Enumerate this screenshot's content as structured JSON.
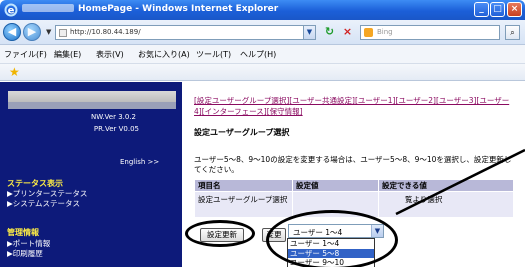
{
  "window": {
    "title": "HomePage - Windows Internet Explorer",
    "min": "_",
    "max": "□",
    "close": "×"
  },
  "nav": {
    "back": "◀",
    "forward": "▶",
    "dropdown": "▼",
    "address": "http://10.80.44.189/",
    "addr_dd": "▼",
    "refresh": "↻",
    "stop": "×",
    "search_placeholder": "Bing",
    "search_go": "⌕"
  },
  "menu": {
    "items": [
      "ファイル(F)",
      "編集(E)",
      "表示(V)",
      "お気に入り(A)",
      "ツール(T)",
      "ヘルプ(H)"
    ]
  },
  "sidebar": {
    "nw_ver": "NW.Ver 3.0.2",
    "pr_ver": "PR.Ver V0.05",
    "lang": "English >>",
    "status_head": "ステータス表示",
    "status_links": [
      "▶プリンターステータス",
      "▶システムステータス"
    ],
    "admin_head": "管理情報",
    "admin_links": [
      "▶ポート情報",
      "▶印刷履歴"
    ]
  },
  "content": {
    "link_segments": [
      "[設定ユーザーグループ選択]",
      "[ユーザー共通設定]",
      "[ユーザー1]",
      "[ユーザー2]",
      "[ユーザー3]",
      "[ユーザー4]",
      "[インターフェース]",
      "[保守情報]"
    ],
    "heading": "設定ユーザーグループ選択",
    "description": "ユーザー5～8、9～10の設定を変更する場合は、ユーザー5～8、9～10を選択し、設定更新してください。",
    "table": {
      "headers": [
        "項目名",
        "設定値",
        "設定できる値"
      ],
      "row_item": "設定ユーザーグループ選択",
      "row_values": "覧より選択"
    },
    "select": {
      "value": "ユーザー 1～4",
      "arrow": "▼",
      "options": [
        "ユーザー 1～4",
        "ユーザー 5～8",
        "ユーザー 9～10"
      ],
      "selected_index": 1
    },
    "buttons": {
      "update": "設定更新",
      "other": "変更"
    }
  }
}
